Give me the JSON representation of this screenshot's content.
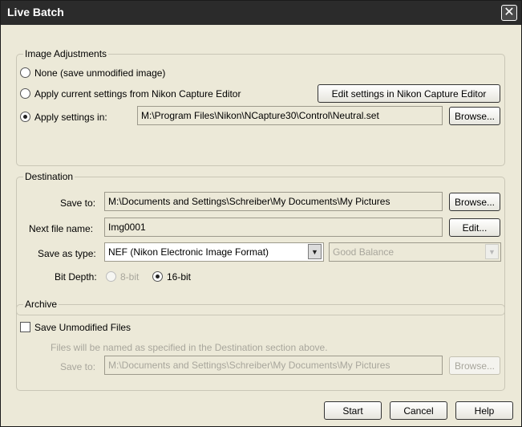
{
  "window": {
    "title": "Live Batch",
    "close_glyph": "✕"
  },
  "image_adjustments": {
    "legend": "Image Adjustments",
    "option_none": "None (save unmodified image)",
    "option_current": "Apply current settings from Nikon Capture Editor",
    "option_apply": "Apply settings in:",
    "edit_button": "Edit settings in Nikon Capture Editor",
    "settings_path": "M:\\Program Files\\Nikon\\NCapture30\\Control\\Neutral.set",
    "browse_button": "Browse..."
  },
  "destination": {
    "legend": "Destination",
    "save_to_label": "Save to:",
    "save_to_path": "M:\\Documents and Settings\\Schreiber\\My Documents\\My Pictures",
    "browse_button": "Browse...",
    "next_file_label": "Next file name:",
    "next_file_value": "Img0001",
    "edit_button": "Edit...",
    "save_as_label": "Save as type:",
    "save_as_value": "NEF (Nikon Electronic Image Format)",
    "quality_value": "Good Balance",
    "bit_depth_label": "Bit Depth:",
    "bit_8": "8-bit",
    "bit_16": "16-bit"
  },
  "archive": {
    "legend": "Archive",
    "save_unmodified": "Save Unmodified Files",
    "note": "Files will be named as specified in the Destination section above.",
    "save_to_label": "Save to:",
    "save_to_path": "M:\\Documents and Settings\\Schreiber\\My Documents\\My Pictures",
    "browse_button": "Browse..."
  },
  "footer": {
    "start": "Start",
    "cancel": "Cancel",
    "help": "Help"
  }
}
